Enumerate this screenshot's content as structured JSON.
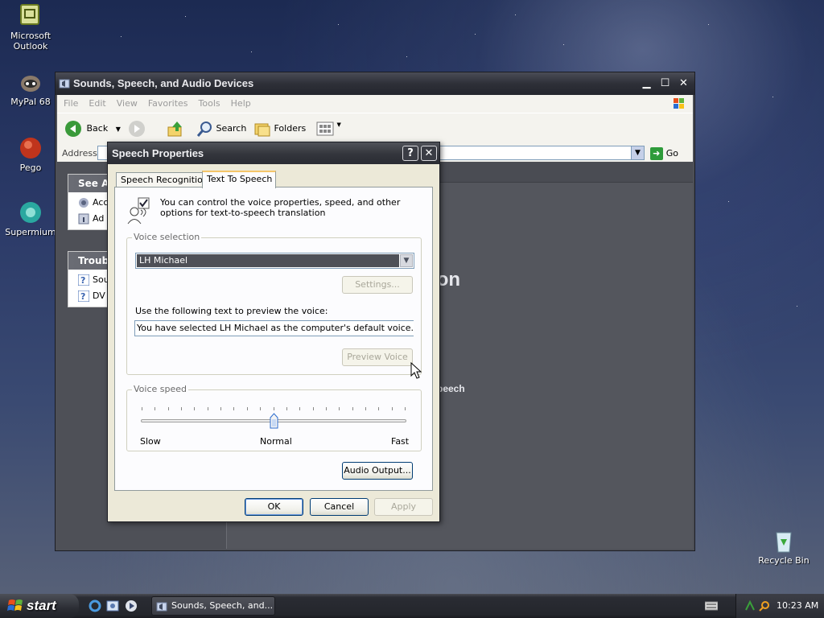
{
  "desktop": {
    "icons": [
      {
        "label": "Microsoft Outlook"
      },
      {
        "label": "MyPal 68"
      },
      {
        "label": "Pego"
      },
      {
        "label": "Supermium"
      },
      {
        "label": "Recycle Bin"
      }
    ]
  },
  "explorer": {
    "title": "Sounds, Speech, and Audio Devices",
    "menu": [
      "File",
      "Edit",
      "View",
      "Favorites",
      "Tools",
      "Help"
    ],
    "toolbar": {
      "back": "Back",
      "search": "Search",
      "folders": "Folders"
    },
    "address": {
      "label": "Address",
      "go": "Go"
    },
    "see_also": {
      "title": "See Al",
      "items": [
        "Acc",
        "Ad"
      ]
    },
    "troubleshooters": {
      "title": "Troubl",
      "items": [
        "Sou",
        "DV"
      ]
    },
    "content_title": "anel icon",
    "content_subtitle": "peech"
  },
  "dialog": {
    "title": "Speech Properties",
    "help_btn": "?",
    "close_btn": "✕",
    "tabs": [
      "Speech Recognition",
      "Text To Speech"
    ],
    "intro": "You can control the voice properties, speed, and other options for text-to-speech translation",
    "voice_selection": {
      "label": "Voice selection",
      "selected": "LH Michael",
      "settings_btn": "Settings...",
      "preview_label": "Use the following text to preview the voice:",
      "preview_text": "You have selected LH Michael as the computer's default voice.",
      "preview_btn": "Preview Voice"
    },
    "voice_speed": {
      "label": "Voice speed",
      "slow": "Slow",
      "normal": "Normal",
      "fast": "Fast",
      "level": 0.5
    },
    "audio_output_btn": "Audio Output...",
    "ok": "OK",
    "cancel": "Cancel",
    "apply": "Apply"
  },
  "taskbar": {
    "start": "start",
    "task": "Sounds, Speech, and...",
    "clock": "10:23 AM"
  }
}
